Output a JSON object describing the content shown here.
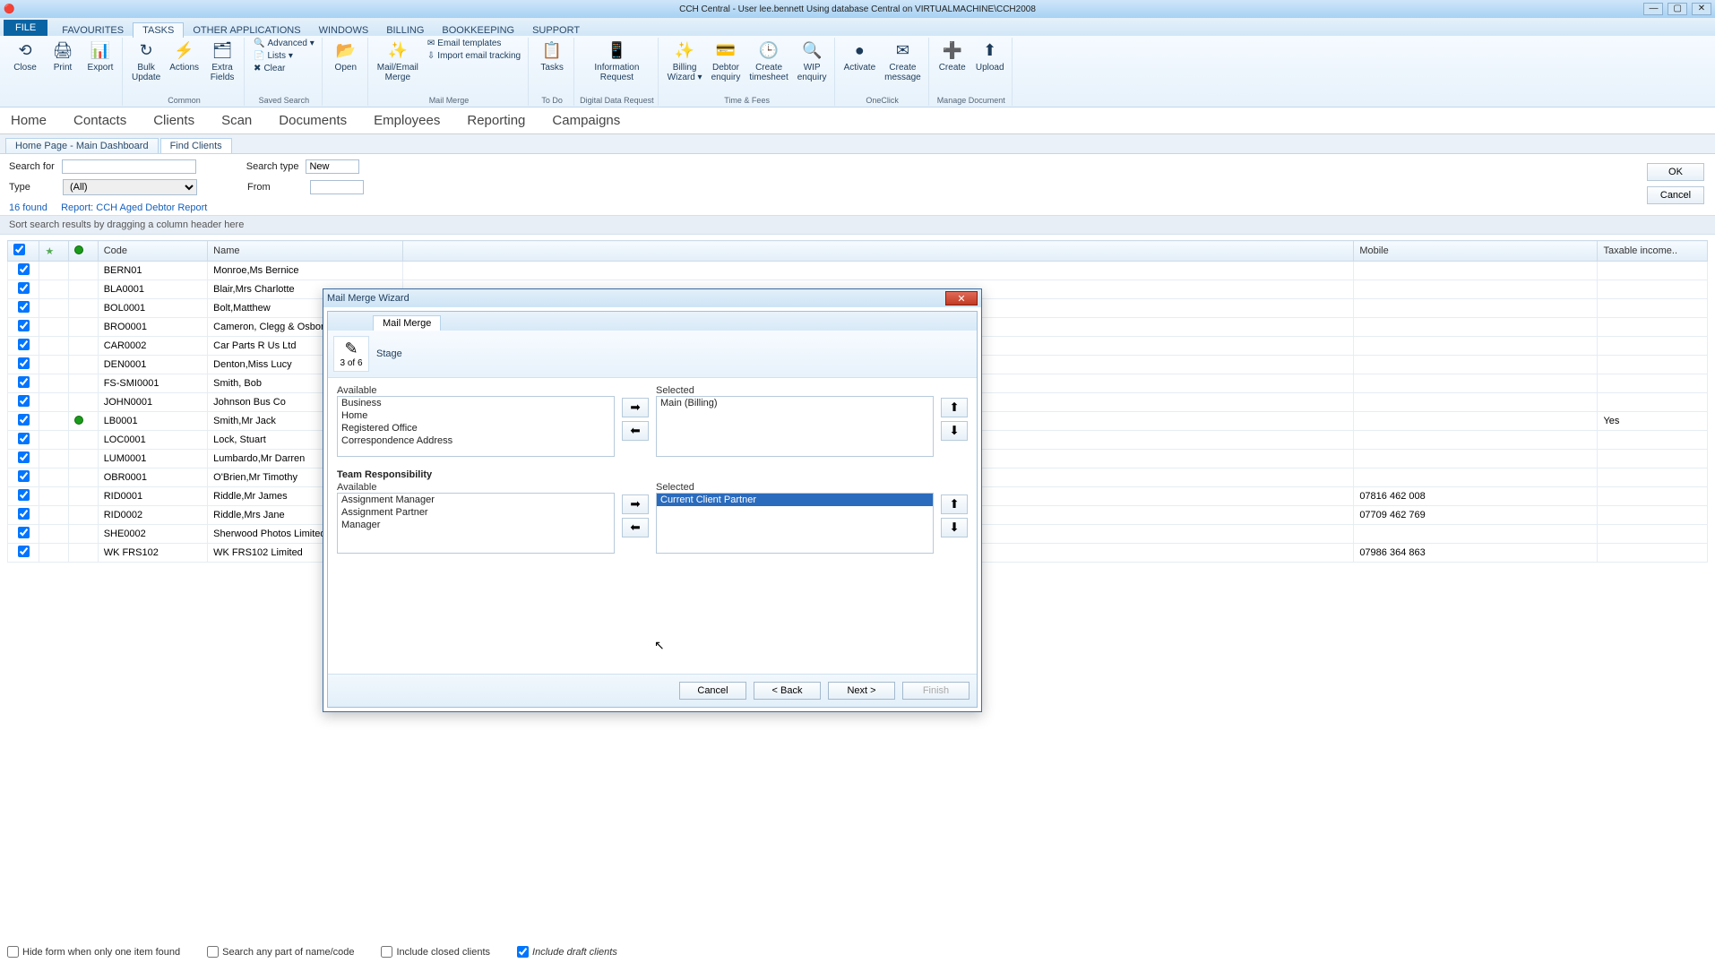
{
  "titlebar": {
    "title": "CCH Central - User lee.bennett Using database Central on VIRTUALMACHINE\\CCH2008"
  },
  "menubar": {
    "file": "FILE",
    "tabs": [
      "FAVOURITES",
      "TASKS",
      "OTHER APPLICATIONS",
      "WINDOWS",
      "BILLING",
      "BOOKKEEPING",
      "SUPPORT"
    ],
    "active": "TASKS"
  },
  "ribbon": {
    "groups": [
      {
        "label": "",
        "buttons": [
          {
            "t": "Close",
            "i": "⟲"
          },
          {
            "t": "Print",
            "i": "🖨"
          },
          {
            "t": "Export",
            "i": "📊"
          }
        ]
      },
      {
        "label": "Common",
        "buttons": [
          {
            "t": "Bulk\nUpdate",
            "i": "↻"
          },
          {
            "t": "Actions",
            "i": "⚡"
          },
          {
            "t": "Extra\nFields",
            "i": "🗂"
          }
        ]
      },
      {
        "label": "Saved Search",
        "buttons": [],
        "small": [
          {
            "t": "Advanced ▾",
            "i": "🔍"
          },
          {
            "t": "Lists ▾",
            "i": "📄"
          },
          {
            "t": "Clear",
            "i": "✖"
          }
        ]
      },
      {
        "label": "",
        "buttons": [
          {
            "t": "Open",
            "i": "📂"
          }
        ]
      },
      {
        "label": "Mail Merge",
        "buttons": [
          {
            "t": "Mail/Email\nMerge",
            "i": "✨"
          }
        ],
        "small": [
          {
            "t": "Email templates",
            "i": "✉"
          },
          {
            "t": "Import email tracking",
            "i": "⇩"
          }
        ]
      },
      {
        "label": "To Do",
        "buttons": [
          {
            "t": "Tasks",
            "i": "📋"
          }
        ]
      },
      {
        "label": "Digital Data Request",
        "buttons": [
          {
            "t": "Information\nRequest",
            "i": "📱"
          }
        ]
      },
      {
        "label": "Time & Fees",
        "buttons": [
          {
            "t": "Billing\nWizard ▾",
            "i": "✨"
          },
          {
            "t": "Debtor\nenquiry",
            "i": "💳"
          },
          {
            "t": "Create\ntimesheet",
            "i": "🕒"
          },
          {
            "t": "WIP\nenquiry",
            "i": "🔍"
          }
        ]
      },
      {
        "label": "OneClick",
        "buttons": [
          {
            "t": "Activate",
            "i": "●"
          },
          {
            "t": "Create\nmessage",
            "i": "✉"
          }
        ]
      },
      {
        "label": "Manage Document",
        "buttons": [
          {
            "t": "Create",
            "i": "➕"
          },
          {
            "t": "Upload",
            "i": "⬆"
          }
        ]
      }
    ]
  },
  "navbar": [
    "Home",
    "Contacts",
    "Clients",
    "Scan",
    "Documents",
    "Employees",
    "Reporting",
    "Campaigns"
  ],
  "pagetabs": [
    {
      "label": "Home Page - Main Dashboard",
      "active": false
    },
    {
      "label": "Find Clients",
      "active": true
    }
  ],
  "search": {
    "searchfor_label": "Search for",
    "searchfor_value": "",
    "searchtype_label": "Search type",
    "searchtype_value": "New",
    "type_label": "Type",
    "type_value": "(All)",
    "from_label": "From"
  },
  "found": {
    "count": "16 found",
    "report_label": "Report:",
    "report_name": "CCH Aged Debtor Report"
  },
  "sort_hint": "Sort search results by dragging a column header here",
  "columns": [
    "",
    "",
    "",
    "Code",
    "Name",
    "",
    "Mobile",
    "Taxable income.."
  ],
  "rows": [
    {
      "chk": true,
      "dot": false,
      "code": "BERN01",
      "name": "Monroe,Ms Bernice",
      "mobile": "",
      "tax": ""
    },
    {
      "chk": true,
      "dot": false,
      "code": "BLA0001",
      "name": "Blair,Mrs Charlotte",
      "mobile": "",
      "tax": ""
    },
    {
      "chk": true,
      "dot": false,
      "code": "BOL0001",
      "name": "Bolt,Matthew",
      "mobile": "",
      "tax": ""
    },
    {
      "chk": true,
      "dot": false,
      "code": "BRO0001",
      "name": "Cameron, Clegg & Osborne Financi",
      "mobile": "",
      "tax": ""
    },
    {
      "chk": true,
      "dot": false,
      "code": "CAR0002",
      "name": "Car Parts R Us Ltd",
      "mobile": "",
      "tax": ""
    },
    {
      "chk": true,
      "dot": false,
      "code": "DEN0001",
      "name": "Denton,Miss Lucy",
      "mobile": "",
      "tax": ""
    },
    {
      "chk": true,
      "dot": false,
      "code": "FS-SMI0001",
      "name": "Smith, Bob",
      "mobile": "",
      "tax": ""
    },
    {
      "chk": true,
      "dot": false,
      "code": "JOHN0001",
      "name": "Johnson Bus Co",
      "mobile": "",
      "tax": ""
    },
    {
      "chk": true,
      "dot": true,
      "code": "LB0001",
      "name": "Smith,Mr Jack",
      "mobile": "",
      "tax": "Yes"
    },
    {
      "chk": true,
      "dot": false,
      "code": "LOC0001",
      "name": "Lock, Stuart",
      "mobile": "",
      "tax": ""
    },
    {
      "chk": true,
      "dot": false,
      "code": "LUM0001",
      "name": "Lumbardo,Mr Darren",
      "mobile": "",
      "tax": ""
    },
    {
      "chk": true,
      "dot": false,
      "code": "OBR0001",
      "name": "O'Brien,Mr Timothy",
      "mobile": "",
      "tax": ""
    },
    {
      "chk": true,
      "dot": false,
      "code": "RID0001",
      "name": "Riddle,Mr James",
      "mobile": "07816 462 008",
      "tax": ""
    },
    {
      "chk": true,
      "dot": false,
      "code": "RID0002",
      "name": "Riddle,Mrs Jane",
      "mobile": "07709 462 769",
      "tax": ""
    },
    {
      "chk": true,
      "dot": false,
      "code": "SHE0002",
      "name": "Sherwood Photos Limited",
      "mobile": "",
      "tax": ""
    },
    {
      "chk": true,
      "dot": false,
      "code": "WK FRS102",
      "name": "WK FRS102 Limited",
      "mobile": "07986 364 863",
      "tax": ""
    }
  ],
  "right_actions": {
    "ok": "OK",
    "cancel": "Cancel"
  },
  "wizard": {
    "title": "Mail Merge Wizard",
    "tab": "Mail Merge",
    "stage_count": "3 of 6",
    "stage_label": "Stage",
    "section1": {
      "available_label": "Available",
      "available": [
        "Business",
        "Home",
        "Registered Office",
        "Correspondence Address"
      ],
      "selected_label": "Selected",
      "selected": [
        "Main (Billing)"
      ]
    },
    "section2": {
      "heading": "Team Responsibility",
      "available_label": "Available",
      "available": [
        "Assignment Manager",
        "Assignment Partner",
        "Manager"
      ],
      "selected_label": "Selected",
      "selected": [
        "Current Client Partner"
      ]
    },
    "buttons": {
      "cancel": "Cancel",
      "back": "< Back",
      "next": "Next >",
      "finish": "Finish"
    }
  },
  "bottom": {
    "hide": "Hide form when only one item found",
    "anypart": "Search any part of name/code",
    "closed": "Include closed clients",
    "draft": "Include draft clients"
  }
}
